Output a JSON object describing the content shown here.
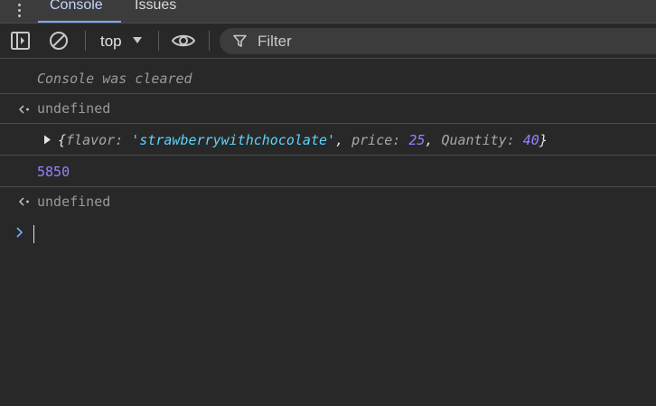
{
  "tabs": {
    "console_label": "Console",
    "issues_label": "Issues"
  },
  "toolbar": {
    "context_value": "top",
    "filter_placeholder": "Filter"
  },
  "console": {
    "cleared_message": "Console was cleared",
    "result1": "undefined",
    "object_log": {
      "open_brace": "{",
      "key1": "flavor",
      "val1": "'strawberrywithchocolate'",
      "key2": "price",
      "val2": "25",
      "key3": "Quantity",
      "val3": "40",
      "close_brace": "}",
      "colon": ": ",
      "comma": ", "
    },
    "number_log": "5850",
    "result2": "undefined"
  },
  "colors": {
    "background": "#282828",
    "tab_accent": "#7cacf8",
    "number": "#9980ff",
    "string": "#5cd5fb",
    "muted_text": "#9a9a9a"
  },
  "icons": [
    "more-vert-icon",
    "sidebar-toggle-icon",
    "clear-console-icon",
    "chevron-down-icon",
    "eye-icon",
    "filter-icon",
    "result-arrow-icon",
    "expand-triangle-icon",
    "prompt-chevron-icon"
  ]
}
